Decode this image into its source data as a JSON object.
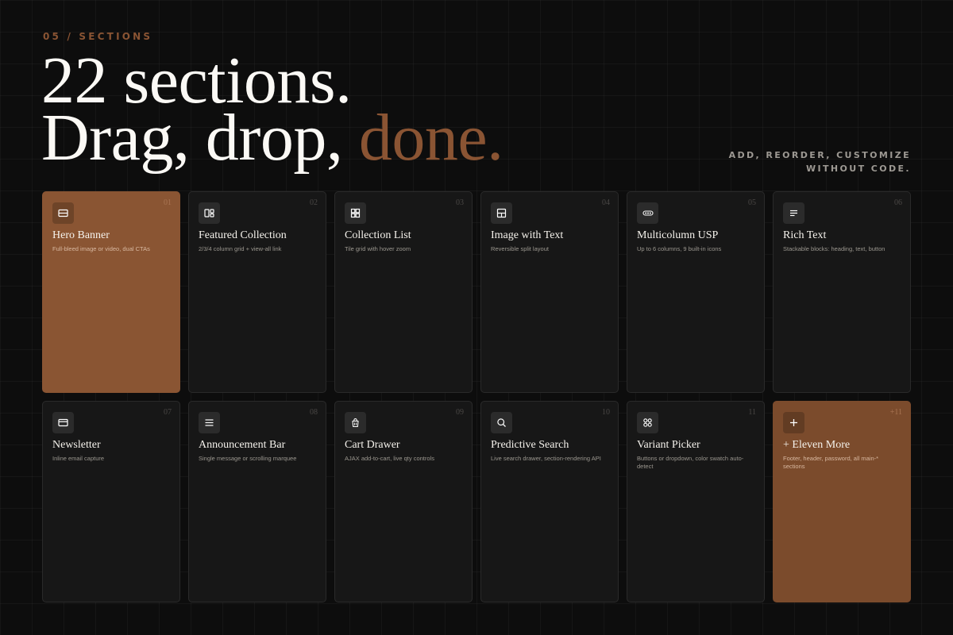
{
  "eyebrow": "05 / SECTIONS",
  "headline": {
    "line1": "22 sections.",
    "line2_start": "Drag, drop, ",
    "line2_accent": "done."
  },
  "tagline": {
    "line1": "ADD, REORDER, CUSTOMIZE",
    "line2": "WITHOUT CODE."
  },
  "colors": {
    "accent": "#8a5433",
    "background": "#0d0d0d",
    "card": "#171717"
  },
  "sections": [
    {
      "num": "01",
      "title": "Hero Banner",
      "desc": "Full-bleed image or video, dual CTAs",
      "icon": "image-banner-icon"
    },
    {
      "num": "02",
      "title": "Featured Collection",
      "desc": "2/3/4 column grid + view-all link",
      "icon": "collection-grid-icon"
    },
    {
      "num": "03",
      "title": "Collection List",
      "desc": "Tile grid with hover zoom",
      "icon": "tile-grid-icon"
    },
    {
      "num": "04",
      "title": "Image with Text",
      "desc": "Reversible split layout",
      "icon": "split-layout-icon"
    },
    {
      "num": "05",
      "title": "Multicolumn USP",
      "desc": "Up to 6 columns, 9 built-in icons",
      "icon": "columns-dots-icon"
    },
    {
      "num": "06",
      "title": "Rich Text",
      "desc": "Stackable blocks: heading, text, button",
      "icon": "text-lines-icon"
    },
    {
      "num": "07",
      "title": "Newsletter",
      "desc": "Inline email capture",
      "icon": "email-card-icon"
    },
    {
      "num": "08",
      "title": "Announcement Bar",
      "desc": "Single message or scrolling marquee",
      "icon": "menu-lines-icon"
    },
    {
      "num": "09",
      "title": "Cart Drawer",
      "desc": "AJAX add-to-cart, live qty controls",
      "icon": "shopping-bag-icon"
    },
    {
      "num": "10",
      "title": "Predictive Search",
      "desc": "Live search drawer, section-rendering API",
      "icon": "search-icon"
    },
    {
      "num": "11",
      "title": "Variant Picker",
      "desc": "Buttons or dropdown, color swatch auto-detect",
      "icon": "swatches-icon"
    },
    {
      "num": "+11",
      "title": "+ Eleven More",
      "desc": "Footer, header, password, all main-* sections",
      "icon": "plus-icon"
    }
  ]
}
